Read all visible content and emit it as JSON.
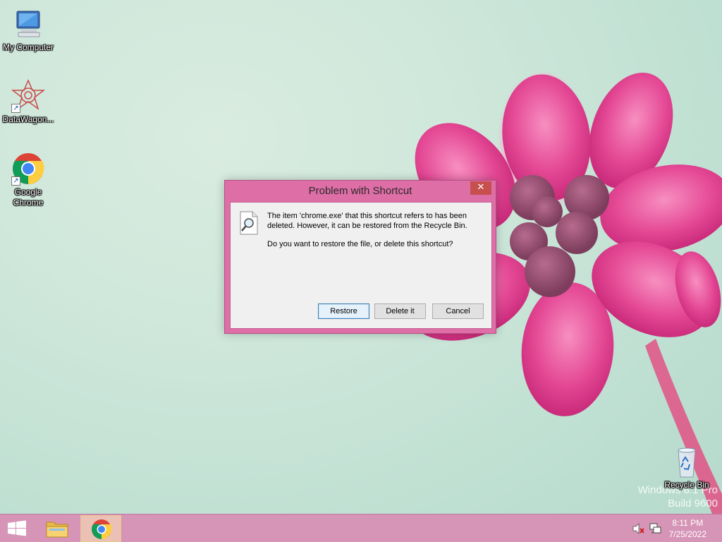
{
  "desktop": {
    "icons": [
      {
        "label": "My Computer"
      },
      {
        "label": "DataWagon..."
      },
      {
        "label": "Google Chrome"
      },
      {
        "label": "Recycle Bin"
      }
    ],
    "watermark": {
      "line1": "Windows 8.1 Pro",
      "line2": "Build 9600"
    }
  },
  "dialog": {
    "title": "Problem with Shortcut",
    "close_label": "✕",
    "message1": "The item 'chrome.exe' that this shortcut refers to has been deleted. However, it can be restored from the Recycle Bin.",
    "message2": "Do you want to restore the file, or delete this shortcut?",
    "buttons": {
      "restore": "Restore",
      "delete": "Delete it",
      "cancel": "Cancel"
    }
  },
  "taskbar": {
    "time": "8:11 PM",
    "date": "7/25/2022"
  },
  "colors": {
    "dialog_frame": "#de6ea6",
    "taskbar": "#d694b6",
    "close_button": "#c7504f"
  }
}
